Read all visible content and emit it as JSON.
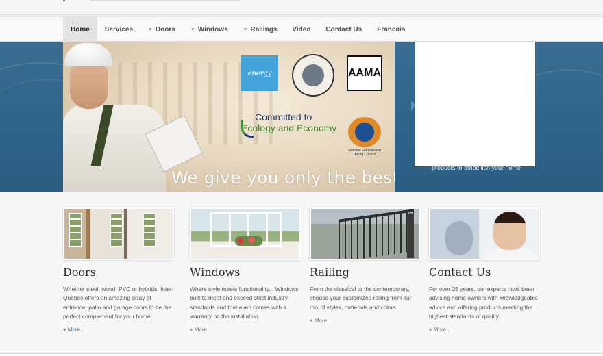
{
  "nav": {
    "items": [
      {
        "label": "Home",
        "active": true,
        "dropdown": false
      },
      {
        "label": "Services",
        "active": false,
        "dropdown": false
      },
      {
        "label": "Doors",
        "active": false,
        "dropdown": true
      },
      {
        "label": "Windows",
        "active": false,
        "dropdown": true
      },
      {
        "label": "Railings",
        "active": false,
        "dropdown": true
      },
      {
        "label": "Video",
        "active": false,
        "dropdown": false
      },
      {
        "label": "Contact Us",
        "active": false,
        "dropdown": false
      },
      {
        "label": "Francais",
        "active": false,
        "dropdown": false
      }
    ]
  },
  "hero": {
    "logos": {
      "energy": "energy",
      "aama": "AAMA",
      "nfrc_caption": "National Fenestration Rating Council"
    },
    "committed_line1": "Committed to",
    "committed_line2": "Ecology and Economy",
    "slogan": "We give you only the best",
    "side_caption": "products to embellish your home"
  },
  "columns": [
    {
      "title": "Doors",
      "text": "Whether steel, wood, PVC or hybrids, Inter-Quebec offers an amazing array of entrance, patio and garage doors to be the perfect complement for your home.",
      "more": "+ More..."
    },
    {
      "title": "Windows",
      "text": "Where style meets functionality... Windows built to meet and exceed strict industry standards and that even comes with a warranty on the installation.",
      "more": "+ More ..."
    },
    {
      "title": "Railing",
      "text": "From the classical to the contemporary, choose your customized railing from our mix of styles, materials and colors.",
      "more": "+ More..."
    },
    {
      "title": "Contact Us",
      "text": "For over 25 years, our experts have been advising home owners with knowledgeable advice and offering products meeting the highest standards of quality.",
      "more": "+ More..."
    }
  ],
  "colors": {
    "hero_blue": "#2f6489",
    "nav_active_bg": "#e3e3e3",
    "link_blue": "#3f6c93"
  }
}
